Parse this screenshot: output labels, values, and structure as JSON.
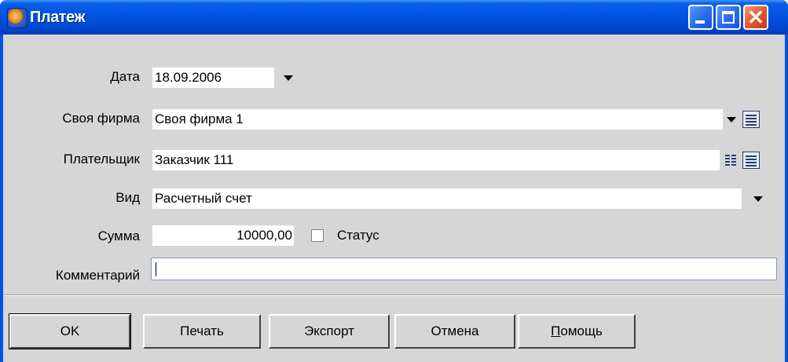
{
  "window": {
    "title": "Платеж"
  },
  "form": {
    "date_label": "Дата",
    "date_value": "18.09.2006",
    "firm_label": "Своя фирма",
    "firm_value": "Своя фирма 1",
    "payer_label": "Плательщик",
    "payer_value": "Заказчик 111",
    "kind_label": "Вид",
    "kind_value": "Расчетный счет",
    "sum_label": "Сумма",
    "sum_value": "10000,00",
    "status_label": "Статус",
    "comment_label": "Комментарий",
    "comment_value": ""
  },
  "buttons": {
    "ok": "OK",
    "print": "Печать",
    "export": "Экспорт",
    "cancel": "Отмена",
    "help_first": "П",
    "help_rest": "омощь"
  }
}
